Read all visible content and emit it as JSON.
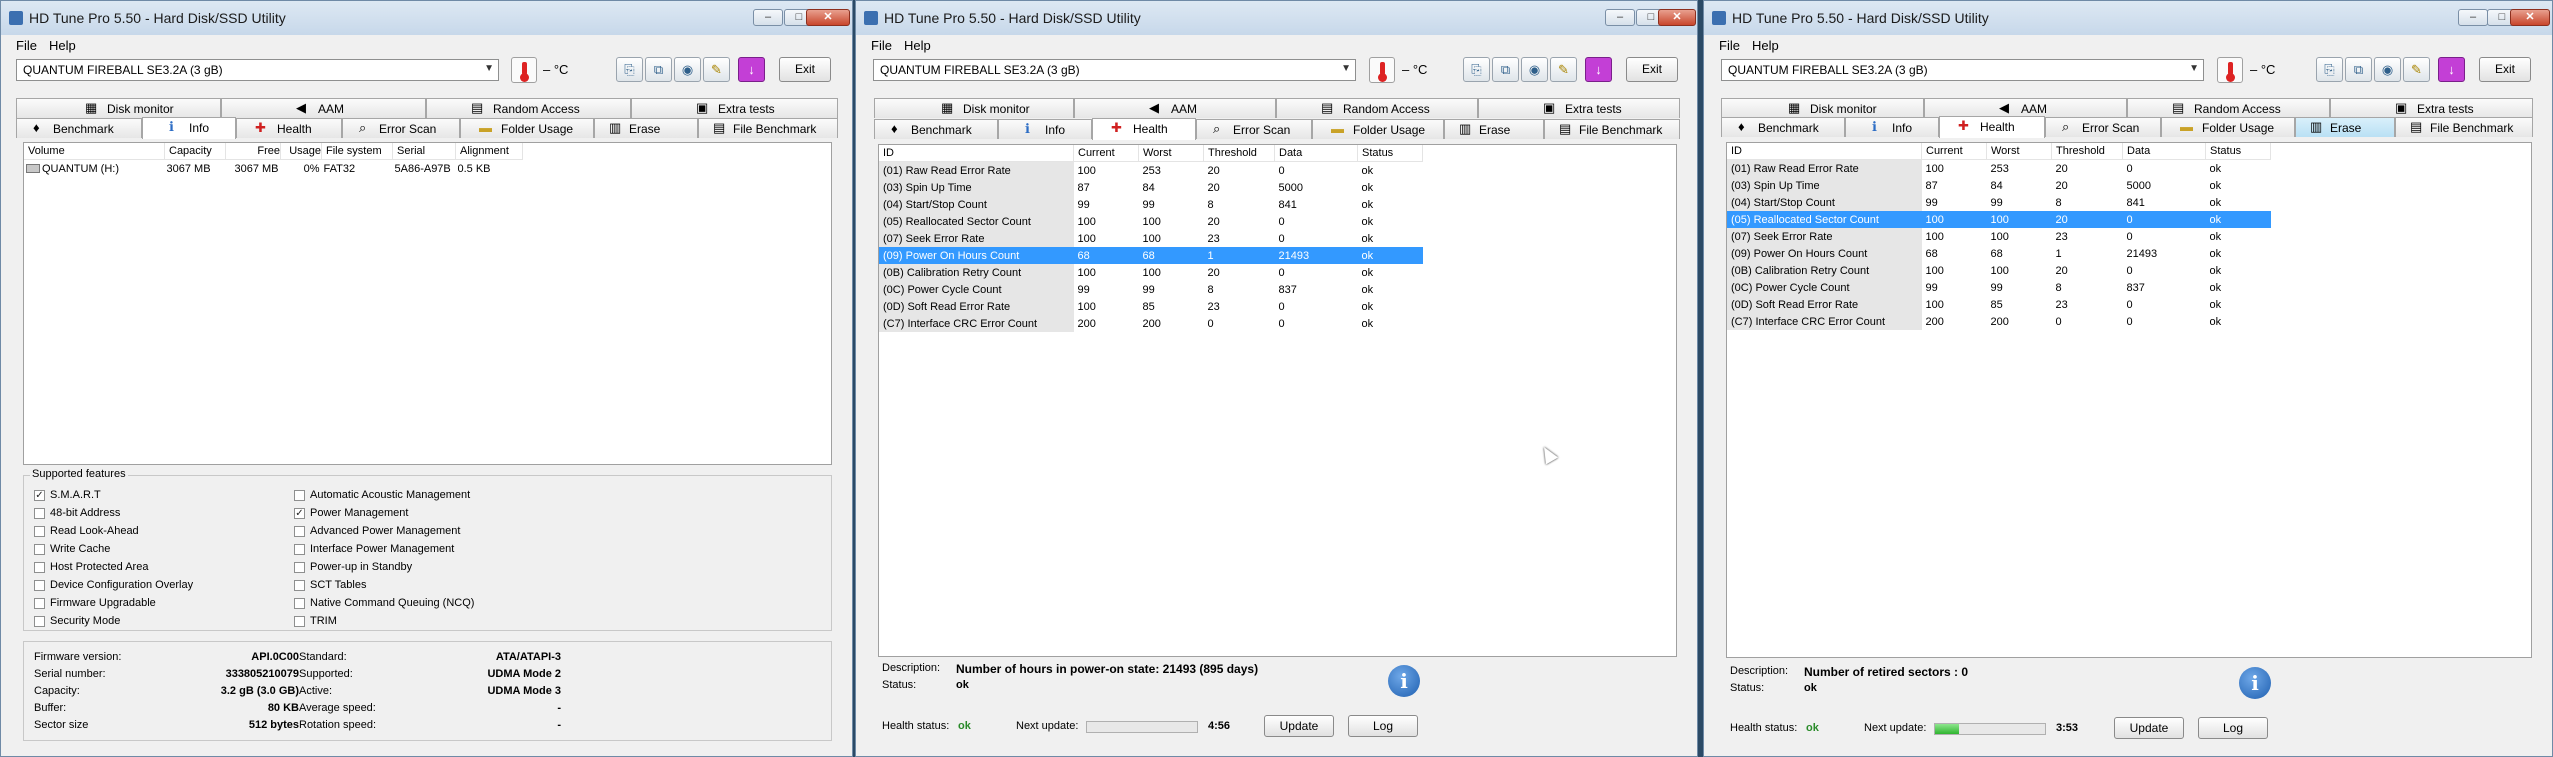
{
  "title": "HD Tune Pro 5.50 - Hard Disk/SSD Utility",
  "menu": {
    "file": "File",
    "help": "Help"
  },
  "drive": "QUANTUM FIREBALL SE3.2A (3 gB)",
  "temperature": "– °C",
  "exit_label": "Exit",
  "window_buttons": {
    "minimize": "–",
    "maximize": "□",
    "close": "✕"
  },
  "toolbar_icons": [
    "copy-icon",
    "copy-all-icon",
    "screenshot-icon",
    "options-icon",
    "save-icon"
  ],
  "tabs_top": [
    "Disk monitor",
    "AAM",
    "Random Access",
    "Extra tests"
  ],
  "tabs_bottom": [
    "Benchmark",
    "Info",
    "Health",
    "Error Scan",
    "Folder Usage",
    "Erase",
    "File Benchmark"
  ],
  "info": {
    "columns": [
      "Volume",
      "Capacity",
      "Free",
      "Usage",
      "File system",
      "Serial",
      "Alignment"
    ],
    "rows": [
      {
        "volume": "QUANTUM (H:)",
        "capacity": "3067 MB",
        "free": "3067 MB",
        "usage": "0%",
        "fs": "FAT32",
        "serial": "5A86-A97B",
        "alignment": "0.5 KB"
      }
    ],
    "supported_features_label": "Supported features",
    "features_left": [
      {
        "label": "S.M.A.R.T",
        "checked": true
      },
      {
        "label": "48-bit Address",
        "checked": false
      },
      {
        "label": "Read Look-Ahead",
        "checked": false
      },
      {
        "label": "Write Cache",
        "checked": false
      },
      {
        "label": "Host Protected Area",
        "checked": false
      },
      {
        "label": "Device Configuration Overlay",
        "checked": false
      },
      {
        "label": "Firmware Upgradable",
        "checked": false
      },
      {
        "label": "Security Mode",
        "checked": false
      }
    ],
    "features_right": [
      {
        "label": "Automatic Acoustic Management",
        "checked": false
      },
      {
        "label": "Power Management",
        "checked": true
      },
      {
        "label": "Advanced Power Management",
        "checked": false
      },
      {
        "label": "Interface Power Management",
        "checked": false
      },
      {
        "label": "Power-up in Standby",
        "checked": false
      },
      {
        "label": "SCT Tables",
        "checked": false
      },
      {
        "label": "Native Command Queuing (NCQ)",
        "checked": false
      },
      {
        "label": "TRIM",
        "checked": false
      }
    ],
    "details_left": [
      {
        "label": "Firmware version:",
        "value": "API.0C00"
      },
      {
        "label": "Serial number:",
        "value": "333805210079"
      },
      {
        "label": "Capacity:",
        "value": "3.2 gB (3.0 GB)"
      },
      {
        "label": "Buffer:",
        "value": "80 KB"
      },
      {
        "label": "Sector size",
        "value": "512 bytes"
      }
    ],
    "details_right": [
      {
        "label": "Standard:",
        "value": "ATA/ATAPI-3"
      },
      {
        "label": "Supported:",
        "value": "UDMA Mode 2"
      },
      {
        "label": "Active:",
        "value": "UDMA Mode 3"
      },
      {
        "label": "Average speed:",
        "value": "-"
      },
      {
        "label": "Rotation speed:",
        "value": "-"
      }
    ]
  },
  "health": {
    "columns": [
      "ID",
      "Current",
      "Worst",
      "Threshold",
      "Data",
      "Status"
    ],
    "rows_win2": [
      {
        "id": "(01) Raw Read Error Rate",
        "current": "100",
        "worst": "253",
        "threshold": "20",
        "data": "0",
        "status": "ok"
      },
      {
        "id": "(03) Spin Up Time",
        "current": "87",
        "worst": "84",
        "threshold": "20",
        "data": "5000",
        "status": "ok"
      },
      {
        "id": "(04) Start/Stop Count",
        "current": "99",
        "worst": "99",
        "threshold": "8",
        "data": "841",
        "status": "ok"
      },
      {
        "id": "(05) Reallocated Sector Count",
        "current": "100",
        "worst": "100",
        "threshold": "20",
        "data": "0",
        "status": "ok"
      },
      {
        "id": "(07) Seek Error Rate",
        "current": "100",
        "worst": "100",
        "threshold": "23",
        "data": "0",
        "status": "ok"
      },
      {
        "id": "(09) Power On Hours Count",
        "current": "68",
        "worst": "68",
        "threshold": "1",
        "data": "21493",
        "status": "ok",
        "selected": true
      },
      {
        "id": "(0B) Calibration Retry Count",
        "current": "100",
        "worst": "100",
        "threshold": "20",
        "data": "0",
        "status": "ok"
      },
      {
        "id": "(0C) Power Cycle Count",
        "current": "99",
        "worst": "99",
        "threshold": "8",
        "data": "837",
        "status": "ok"
      },
      {
        "id": "(0D) Soft Read Error Rate",
        "current": "100",
        "worst": "85",
        "threshold": "23",
        "data": "0",
        "status": "ok"
      },
      {
        "id": "(C7) Interface CRC Error Count",
        "current": "200",
        "worst": "200",
        "threshold": "0",
        "data": "0",
        "status": "ok"
      }
    ],
    "rows_win3": [
      {
        "id": "(01) Raw Read Error Rate",
        "current": "100",
        "worst": "253",
        "threshold": "20",
        "data": "0",
        "status": "ok"
      },
      {
        "id": "(03) Spin Up Time",
        "current": "87",
        "worst": "84",
        "threshold": "20",
        "data": "5000",
        "status": "ok"
      },
      {
        "id": "(04) Start/Stop Count",
        "current": "99",
        "worst": "99",
        "threshold": "8",
        "data": "841",
        "status": "ok"
      },
      {
        "id": "(05) Reallocated Sector Count",
        "current": "100",
        "worst": "100",
        "threshold": "20",
        "data": "0",
        "status": "ok",
        "selected": true
      },
      {
        "id": "(07) Seek Error Rate",
        "current": "100",
        "worst": "100",
        "threshold": "23",
        "data": "0",
        "status": "ok"
      },
      {
        "id": "(09) Power On Hours Count",
        "current": "68",
        "worst": "68",
        "threshold": "1",
        "data": "21493",
        "status": "ok"
      },
      {
        "id": "(0B) Calibration Retry Count",
        "current": "100",
        "worst": "100",
        "threshold": "20",
        "data": "0",
        "status": "ok"
      },
      {
        "id": "(0C) Power Cycle Count",
        "current": "99",
        "worst": "99",
        "threshold": "8",
        "data": "837",
        "status": "ok"
      },
      {
        "id": "(0D) Soft Read Error Rate",
        "current": "100",
        "worst": "85",
        "threshold": "23",
        "data": "0",
        "status": "ok"
      },
      {
        "id": "(C7) Interface CRC Error Count",
        "current": "200",
        "worst": "200",
        "threshold": "0",
        "data": "0",
        "status": "ok"
      }
    ],
    "description_label": "Description:",
    "status_label": "Status:",
    "win2_description": "Number of hours in power-on state: 21493 (895 days)",
    "win2_status": "ok",
    "win3_description": "Number of retired sectors : 0",
    "win3_status": "ok",
    "health_status_label": "Health status:",
    "health_status_value": "ok",
    "next_update_label": "Next update:",
    "win2_countdown": "4:56",
    "win3_countdown": "3:53",
    "win2_progress": 0.0,
    "win3_progress": 0.22,
    "update_label": "Update",
    "log_label": "Log"
  },
  "colors": {
    "selection": "#3399ff",
    "ok_green": "#2a8b2a",
    "erase_highlight": "#b9e0f4"
  }
}
